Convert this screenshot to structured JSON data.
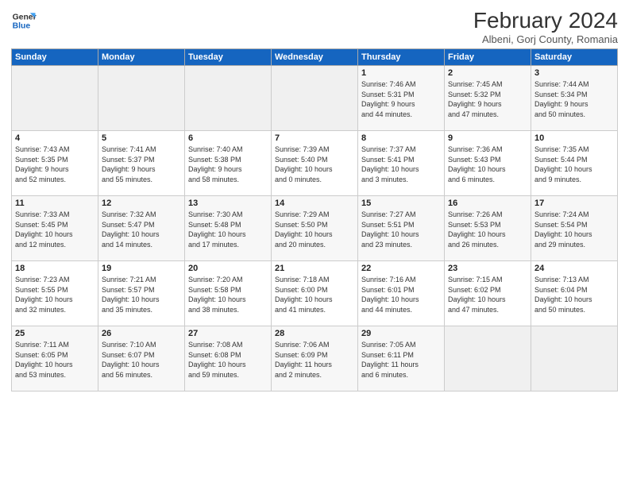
{
  "logo": {
    "line1": "General",
    "line2": "Blue"
  },
  "title": "February 2024",
  "location": "Albeni, Gorj County, Romania",
  "days_of_week": [
    "Sunday",
    "Monday",
    "Tuesday",
    "Wednesday",
    "Thursday",
    "Friday",
    "Saturday"
  ],
  "weeks": [
    [
      {
        "day": "",
        "info": ""
      },
      {
        "day": "",
        "info": ""
      },
      {
        "day": "",
        "info": ""
      },
      {
        "day": "",
        "info": ""
      },
      {
        "day": "1",
        "info": "Sunrise: 7:46 AM\nSunset: 5:31 PM\nDaylight: 9 hours\nand 44 minutes."
      },
      {
        "day": "2",
        "info": "Sunrise: 7:45 AM\nSunset: 5:32 PM\nDaylight: 9 hours\nand 47 minutes."
      },
      {
        "day": "3",
        "info": "Sunrise: 7:44 AM\nSunset: 5:34 PM\nDaylight: 9 hours\nand 50 minutes."
      }
    ],
    [
      {
        "day": "4",
        "info": "Sunrise: 7:43 AM\nSunset: 5:35 PM\nDaylight: 9 hours\nand 52 minutes."
      },
      {
        "day": "5",
        "info": "Sunrise: 7:41 AM\nSunset: 5:37 PM\nDaylight: 9 hours\nand 55 minutes."
      },
      {
        "day": "6",
        "info": "Sunrise: 7:40 AM\nSunset: 5:38 PM\nDaylight: 9 hours\nand 58 minutes."
      },
      {
        "day": "7",
        "info": "Sunrise: 7:39 AM\nSunset: 5:40 PM\nDaylight: 10 hours\nand 0 minutes."
      },
      {
        "day": "8",
        "info": "Sunrise: 7:37 AM\nSunset: 5:41 PM\nDaylight: 10 hours\nand 3 minutes."
      },
      {
        "day": "9",
        "info": "Sunrise: 7:36 AM\nSunset: 5:43 PM\nDaylight: 10 hours\nand 6 minutes."
      },
      {
        "day": "10",
        "info": "Sunrise: 7:35 AM\nSunset: 5:44 PM\nDaylight: 10 hours\nand 9 minutes."
      }
    ],
    [
      {
        "day": "11",
        "info": "Sunrise: 7:33 AM\nSunset: 5:45 PM\nDaylight: 10 hours\nand 12 minutes."
      },
      {
        "day": "12",
        "info": "Sunrise: 7:32 AM\nSunset: 5:47 PM\nDaylight: 10 hours\nand 14 minutes."
      },
      {
        "day": "13",
        "info": "Sunrise: 7:30 AM\nSunset: 5:48 PM\nDaylight: 10 hours\nand 17 minutes."
      },
      {
        "day": "14",
        "info": "Sunrise: 7:29 AM\nSunset: 5:50 PM\nDaylight: 10 hours\nand 20 minutes."
      },
      {
        "day": "15",
        "info": "Sunrise: 7:27 AM\nSunset: 5:51 PM\nDaylight: 10 hours\nand 23 minutes."
      },
      {
        "day": "16",
        "info": "Sunrise: 7:26 AM\nSunset: 5:53 PM\nDaylight: 10 hours\nand 26 minutes."
      },
      {
        "day": "17",
        "info": "Sunrise: 7:24 AM\nSunset: 5:54 PM\nDaylight: 10 hours\nand 29 minutes."
      }
    ],
    [
      {
        "day": "18",
        "info": "Sunrise: 7:23 AM\nSunset: 5:55 PM\nDaylight: 10 hours\nand 32 minutes."
      },
      {
        "day": "19",
        "info": "Sunrise: 7:21 AM\nSunset: 5:57 PM\nDaylight: 10 hours\nand 35 minutes."
      },
      {
        "day": "20",
        "info": "Sunrise: 7:20 AM\nSunset: 5:58 PM\nDaylight: 10 hours\nand 38 minutes."
      },
      {
        "day": "21",
        "info": "Sunrise: 7:18 AM\nSunset: 6:00 PM\nDaylight: 10 hours\nand 41 minutes."
      },
      {
        "day": "22",
        "info": "Sunrise: 7:16 AM\nSunset: 6:01 PM\nDaylight: 10 hours\nand 44 minutes."
      },
      {
        "day": "23",
        "info": "Sunrise: 7:15 AM\nSunset: 6:02 PM\nDaylight: 10 hours\nand 47 minutes."
      },
      {
        "day": "24",
        "info": "Sunrise: 7:13 AM\nSunset: 6:04 PM\nDaylight: 10 hours\nand 50 minutes."
      }
    ],
    [
      {
        "day": "25",
        "info": "Sunrise: 7:11 AM\nSunset: 6:05 PM\nDaylight: 10 hours\nand 53 minutes."
      },
      {
        "day": "26",
        "info": "Sunrise: 7:10 AM\nSunset: 6:07 PM\nDaylight: 10 hours\nand 56 minutes."
      },
      {
        "day": "27",
        "info": "Sunrise: 7:08 AM\nSunset: 6:08 PM\nDaylight: 10 hours\nand 59 minutes."
      },
      {
        "day": "28",
        "info": "Sunrise: 7:06 AM\nSunset: 6:09 PM\nDaylight: 11 hours\nand 2 minutes."
      },
      {
        "day": "29",
        "info": "Sunrise: 7:05 AM\nSunset: 6:11 PM\nDaylight: 11 hours\nand 6 minutes."
      },
      {
        "day": "",
        "info": ""
      },
      {
        "day": "",
        "info": ""
      }
    ]
  ]
}
